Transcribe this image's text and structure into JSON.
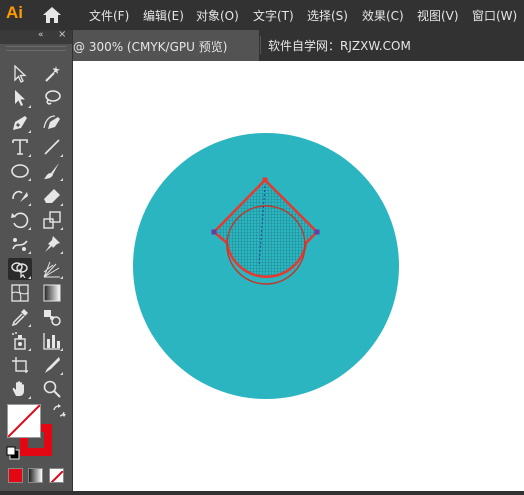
{
  "app": {
    "logo_text": "Ai"
  },
  "menu": [
    {
      "label": "文件(F)"
    },
    {
      "label": "编辑(E)"
    },
    {
      "label": "对象(O)"
    },
    {
      "label": "文字(T)"
    },
    {
      "label": "选择(S)"
    },
    {
      "label": "效果(C)"
    },
    {
      "label": "视图(V)"
    },
    {
      "label": "窗口(W)"
    }
  ],
  "tabs": {
    "active_label": "@ 300% (CMYK/GPU 预览)",
    "active_close": "×",
    "watermark": "软件自学网：RJZXW.COM"
  },
  "toolbar": {
    "collapse_glyph": "«",
    "close_glyph": "×"
  },
  "colors": {
    "circle_fill": "#2bb5c0",
    "path_stroke": "#e8382f",
    "fill_swatch": "#ffffff",
    "stroke_swatch": "#e30613",
    "app_accent": "#ff9a00"
  },
  "tools": [
    "selection-tool",
    "magic-wand-tool",
    "direct-selection-tool",
    "lasso-tool",
    "pen-tool",
    "curvature-tool",
    "type-tool",
    "line-segment-tool",
    "ellipse-tool",
    "paintbrush-tool",
    "shaper-tool",
    "eraser-tool",
    "rotate-tool",
    "scale-tool",
    "puppet-warp-tool",
    "pin-tool",
    "shape-builder-tool",
    "perspective-grid-tool",
    "mesh-tool",
    "gradient-tool",
    "eyedropper-tool",
    "blend-tool",
    "symbol-sprayer-tool",
    "column-graph-tool",
    "artboard-tool",
    "slice-tool",
    "hand-tool",
    "zoom-tool"
  ]
}
